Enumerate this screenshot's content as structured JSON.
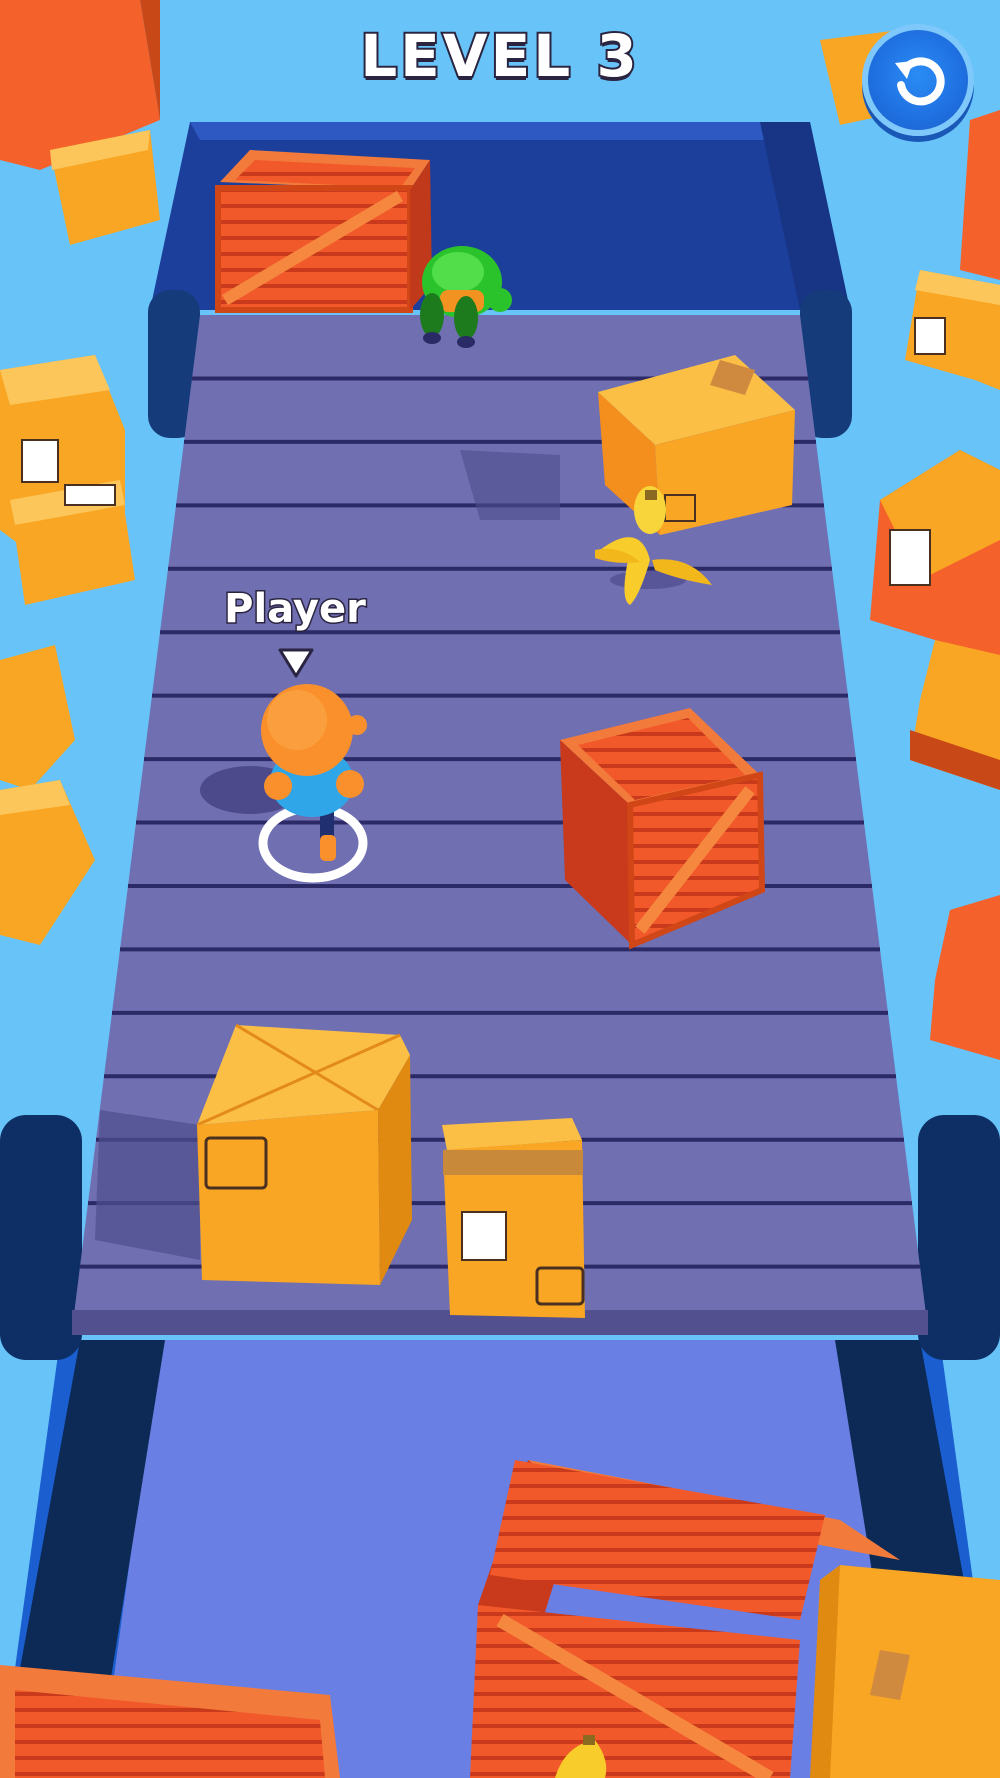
{
  "hud": {
    "level_label": "LEVEL 3",
    "restart_icon": "restart-arrow-icon"
  },
  "player": {
    "name_tag": "Player",
    "pointer_icon": "down-triangle-icon"
  },
  "colors": {
    "sky": "#67c3f8",
    "belt": "#6f6fb2",
    "belt_wall": "#1d3f9c",
    "orange_crate": "#f4612a",
    "cardboard_box": "#f8a623",
    "player_head": "#f9902b",
    "player_shirt": "#2fa6e8",
    "enemy": "#2bc32b"
  }
}
